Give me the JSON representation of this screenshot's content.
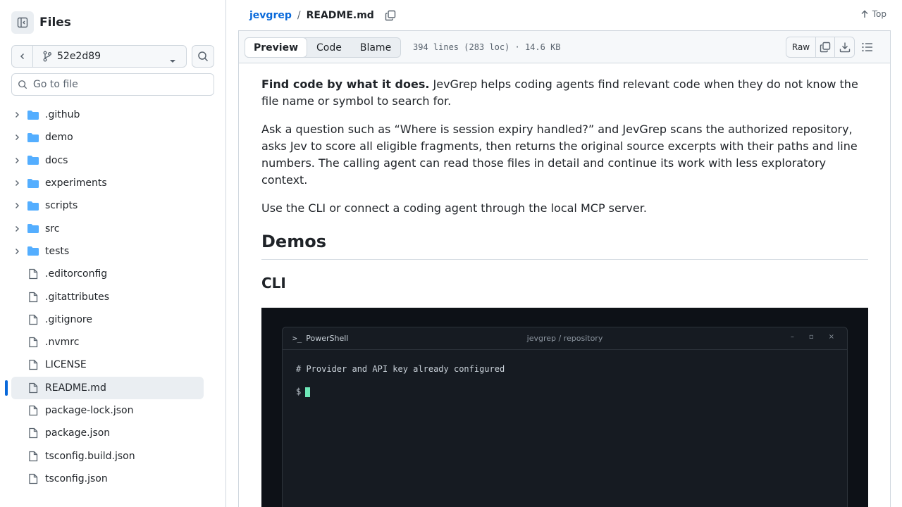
{
  "sidebar": {
    "title": "Files",
    "branch": "52e2d89",
    "goto_placeholder": "Go to file",
    "items": [
      {
        "label": ".github",
        "kind": "folder"
      },
      {
        "label": "demo",
        "kind": "folder"
      },
      {
        "label": "docs",
        "kind": "folder"
      },
      {
        "label": "experiments",
        "kind": "folder"
      },
      {
        "label": "scripts",
        "kind": "folder"
      },
      {
        "label": "src",
        "kind": "folder"
      },
      {
        "label": "tests",
        "kind": "folder"
      },
      {
        "label": ".editorconfig",
        "kind": "file"
      },
      {
        "label": ".gitattributes",
        "kind": "file"
      },
      {
        "label": ".gitignore",
        "kind": "file"
      },
      {
        "label": ".nvmrc",
        "kind": "file"
      },
      {
        "label": "LICENSE",
        "kind": "file"
      },
      {
        "label": "README.md",
        "kind": "file",
        "selected": true
      },
      {
        "label": "package-lock.json",
        "kind": "file"
      },
      {
        "label": "package.json",
        "kind": "file"
      },
      {
        "label": "tsconfig.build.json",
        "kind": "file"
      },
      {
        "label": "tsconfig.json",
        "kind": "file"
      }
    ]
  },
  "header": {
    "repo": "jevgrep",
    "separator": "/",
    "file": "README.md",
    "top_label": "Top"
  },
  "toolbar": {
    "tabs": [
      {
        "label": "Preview",
        "active": true
      },
      {
        "label": "Code"
      },
      {
        "label": "Blame"
      }
    ],
    "meta": "394 lines (283 loc) · 14.6 KB",
    "raw_label": "Raw"
  },
  "readme": {
    "p1_bold": "Find code by what it does.",
    "p1_rest": " JevGrep helps coding agents find relevant code when they do not know the file name or symbol to search for.",
    "p2": "Ask a question such as “Where is session expiry handled?” and JevGrep scans the authorized repository, asks Jev to score all eligible fragments, then returns the original source excerpts with their paths and line numbers. The calling agent can read those files in detail and continue its work with less exploratory context.",
    "p3": "Use the CLI or connect a coding agent through the local MCP server.",
    "h2": "Demos",
    "h3": "CLI"
  },
  "terminal": {
    "prompt_glyph": ">_",
    "app": "PowerShell",
    "title": "jevgrep / repository",
    "min": "–",
    "max": "▫",
    "close": "×",
    "line1": "# Provider and API key already configured",
    "line2_prompt": "$"
  },
  "colors": {
    "accent": "#0969da",
    "folder": "#54aeff",
    "cursor": "#6ee7b7"
  }
}
